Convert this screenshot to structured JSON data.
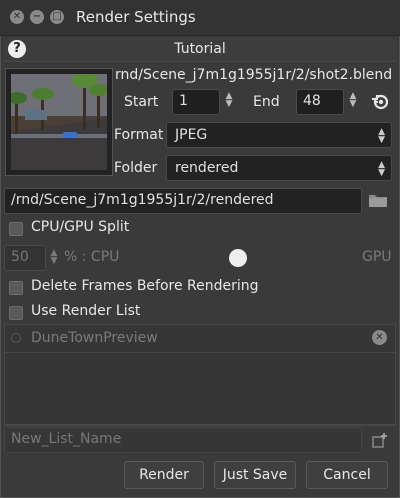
{
  "window": {
    "title": "Render Settings",
    "tutorial": "Tutorial"
  },
  "scene": {
    "path": "rnd/Scene_j7m1g1955j1r/2/shot2.blend"
  },
  "range": {
    "start_label": "Start",
    "start_value": "1",
    "end_label": "End",
    "end_value": "48"
  },
  "format": {
    "label": "Format",
    "value": "JPEG"
  },
  "folder": {
    "label": "Folder",
    "value": "rendered"
  },
  "output_path": "/rnd/Scene_j7m1g1955j1r/2/rendered",
  "options": {
    "cpu_gpu_split": "CPU/GPU Split",
    "split_value": "50",
    "split_cpu": "% : CPU",
    "split_gpu": "GPU",
    "delete_frames": "Delete Frames Before Rendering",
    "use_render_list": "Use Render List"
  },
  "render_list": {
    "items": [
      "DuneTownPreview"
    ]
  },
  "new_list": {
    "placeholder": "New_List_Name"
  },
  "buttons": {
    "render": "Render",
    "just_save": "Just Save",
    "cancel": "Cancel"
  },
  "icons": {
    "help": "help-icon",
    "blender": "blender-icon",
    "folder": "folder-icon",
    "clear": "clear-icon",
    "add_list": "add-list-icon"
  }
}
